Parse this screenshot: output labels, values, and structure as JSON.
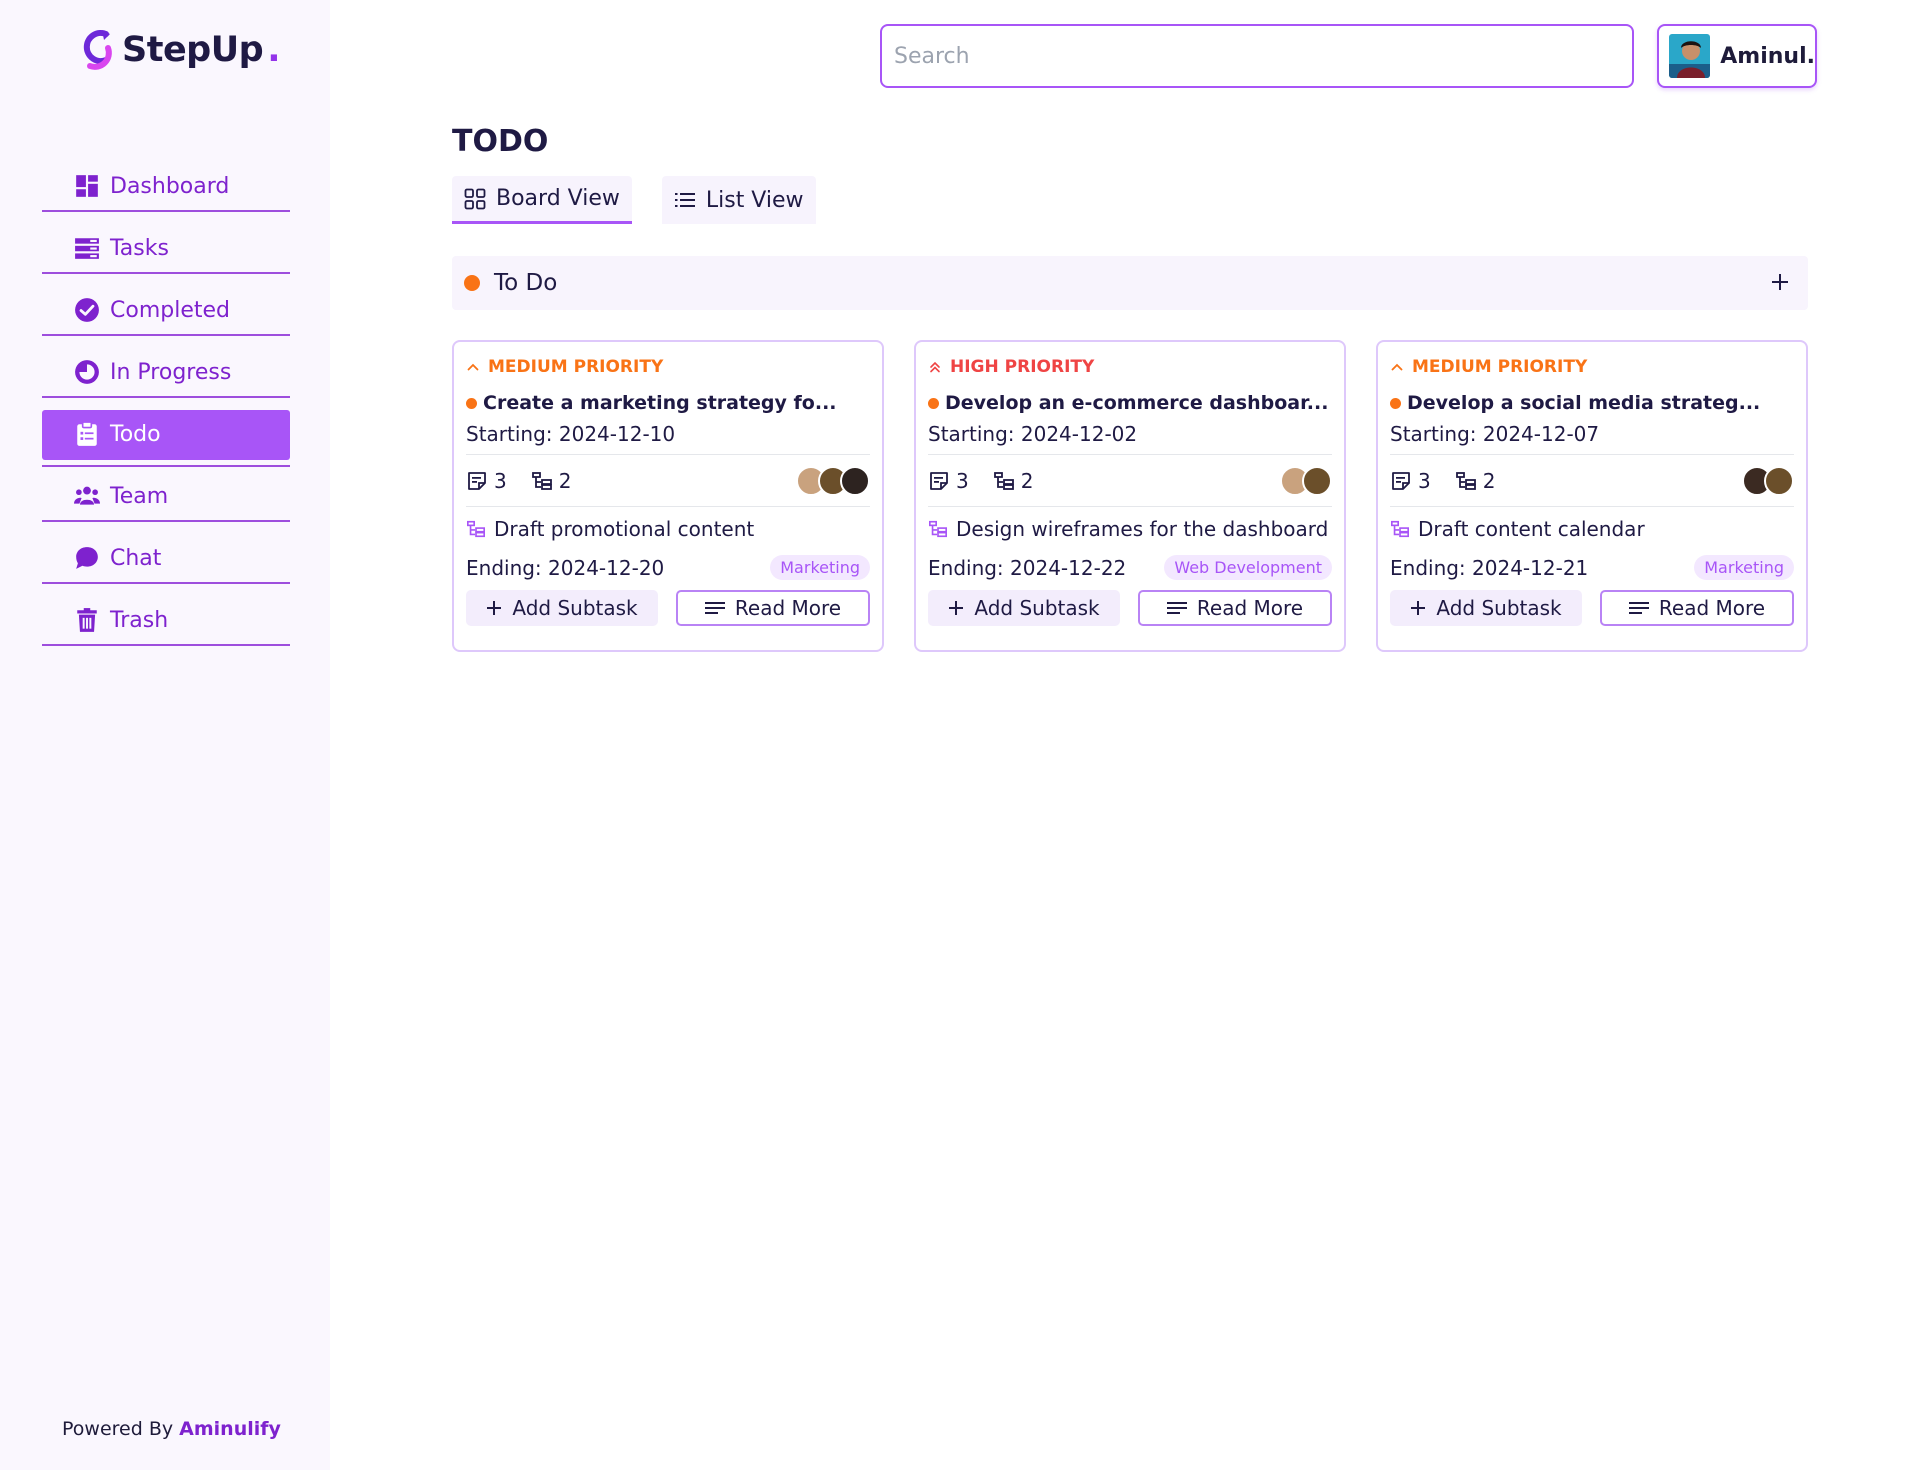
{
  "brand": {
    "name": "StepUp",
    "dot": "."
  },
  "sidebar": {
    "items": [
      {
        "label": "Dashboard",
        "icon": "dashboard-icon"
      },
      {
        "label": "Tasks",
        "icon": "tasks-icon"
      },
      {
        "label": "Completed",
        "icon": "check-circle-icon"
      },
      {
        "label": "In Progress",
        "icon": "progress-icon"
      },
      {
        "label": "Todo",
        "icon": "clipboard-icon",
        "active": true
      },
      {
        "label": "Team",
        "icon": "team-icon"
      },
      {
        "label": "Chat",
        "icon": "chat-icon"
      },
      {
        "label": "Trash",
        "icon": "trash-icon"
      }
    ],
    "footer": {
      "prefix": "Powered By",
      "brand": "Aminulify"
    }
  },
  "header": {
    "search_placeholder": "Search",
    "user_name": "Aminul."
  },
  "main": {
    "title": "TODO",
    "tabs": [
      {
        "label": "Board View",
        "active": true
      },
      {
        "label": "List View",
        "active": false
      }
    ],
    "group": {
      "label": "To Do",
      "color": "#f97316"
    },
    "cards": [
      {
        "priority": "MEDIUM PRIORITY",
        "priority_color": "#f97316",
        "priority_icon": "chevron-up-icon",
        "title": "Create a marketing strategy fo...",
        "start": "Starting: 2024-12-10",
        "notes": "3",
        "subtasks": "2",
        "avatars": [
          "#c9a27e",
          "#6b4f2a",
          "#2d2320"
        ],
        "subtask_name": "Draft promotional content",
        "end": "Ending: 2024-12-20",
        "tag": "Marketing",
        "add_label": "Add Subtask",
        "read_label": "Read More"
      },
      {
        "priority": "HIGH PRIORITY",
        "priority_color": "#ef4444",
        "priority_icon": "double-chevron-up-icon",
        "title": "Develop an e-commerce dashboar...",
        "start": "Starting: 2024-12-02",
        "notes": "3",
        "subtasks": "2",
        "avatars": [
          "#c9a27e",
          "#6b4f2a"
        ],
        "subtask_name": "Design wireframes for the dashboard",
        "end": "Ending: 2024-12-22",
        "tag": "Web Development",
        "add_label": "Add Subtask",
        "read_label": "Read More"
      },
      {
        "priority": "MEDIUM PRIORITY",
        "priority_color": "#f97316",
        "priority_icon": "chevron-up-icon",
        "title": "Develop a social media strateg...",
        "start": "Starting: 2024-12-07",
        "notes": "3",
        "subtasks": "2",
        "avatars": [
          "#3b2a22",
          "#6b4f2a"
        ],
        "subtask_name": "Draft content calendar",
        "end": "Ending: 2024-12-21",
        "tag": "Marketing",
        "add_label": "Add Subtask",
        "read_label": "Read More"
      }
    ]
  },
  "colors": {
    "accent": "#a855f7",
    "accent_dark": "#7e22ce",
    "sidebar_bg": "#faf7fe"
  }
}
